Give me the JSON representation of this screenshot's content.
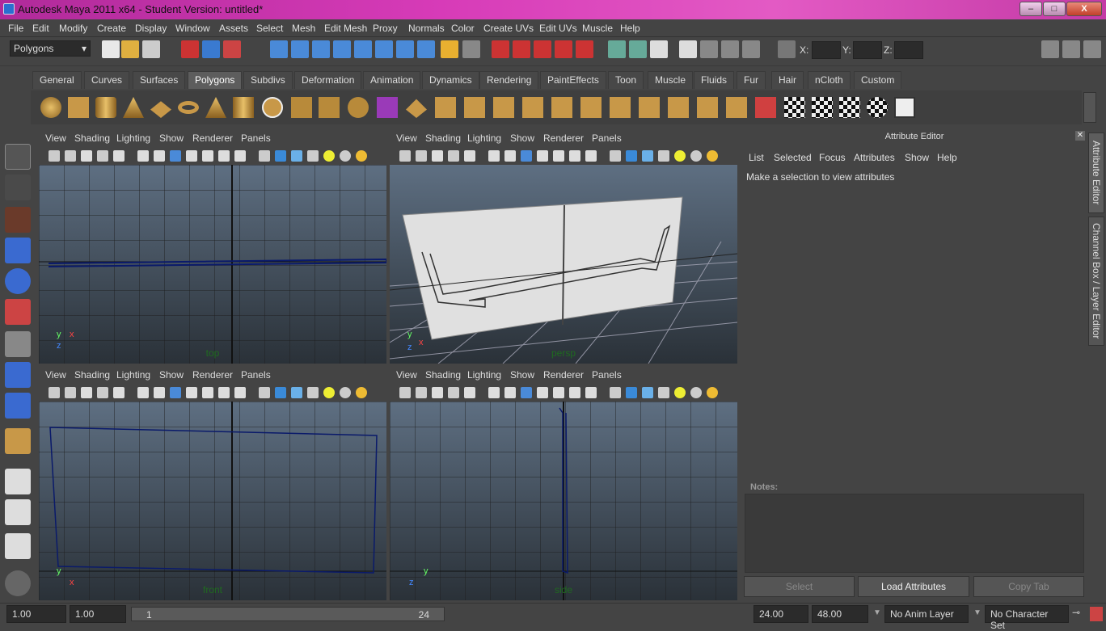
{
  "window": {
    "title": "Autodesk Maya 2011 x64 - Student Version: untitled*",
    "minimize": "–",
    "maximize": "□",
    "close": "X"
  },
  "menubar": [
    "File",
    "Edit",
    "Modify",
    "Create",
    "Display",
    "Window",
    "Assets",
    "Select",
    "Mesh",
    "Edit Mesh",
    "Proxy",
    "Normals",
    "Color",
    "Create UVs",
    "Edit UVs",
    "Muscle",
    "Help"
  ],
  "statusline": {
    "menu_set": "Polygons",
    "x_label": "X:",
    "y_label": "Y:",
    "z_label": "Z:"
  },
  "shelf_tabs": [
    "General",
    "Curves",
    "Surfaces",
    "Polygons",
    "Subdivs",
    "Deformation",
    "Animation",
    "Dynamics",
    "Rendering",
    "PaintEffects",
    "Toon",
    "Muscle",
    "Fluids",
    "Fur",
    "Hair",
    "nCloth",
    "Custom"
  ],
  "shelf_active": "Polygons",
  "viewport_menu": [
    "View",
    "Shading",
    "Lighting",
    "Show",
    "Renderer",
    "Panels"
  ],
  "viewports": [
    {
      "camera": "top"
    },
    {
      "camera": "persp"
    },
    {
      "camera": "front"
    },
    {
      "camera": "side"
    }
  ],
  "axis_labels": {
    "x": "x",
    "y": "y",
    "z": "z"
  },
  "attribute_editor": {
    "title": "Attribute Editor",
    "menu": [
      "List",
      "Selected",
      "Focus",
      "Attributes",
      "Show",
      "Help"
    ],
    "message": "Make a selection to view attributes",
    "notes_label": "Notes:",
    "select_button": "Select",
    "load_button": "Load Attributes",
    "copy_button": "Copy Tab"
  },
  "side_tabs": [
    "Attribute Editor",
    "Channel Box / Layer Editor"
  ],
  "bottom": {
    "start": "1.00",
    "range_start": "1.00",
    "slider_start": "1",
    "slider_end": "24",
    "range_end": "24.00",
    "end": "48.00",
    "anim_layer": "No Anim Layer",
    "character_set": "No Character Set"
  },
  "colors": {
    "title_bar": "#d73bb8",
    "viewport_top": "#5e6f82",
    "viewport_bottom": "#2a3138",
    "wire": "#0a1a6a",
    "plane": "#e0e0e0"
  }
}
